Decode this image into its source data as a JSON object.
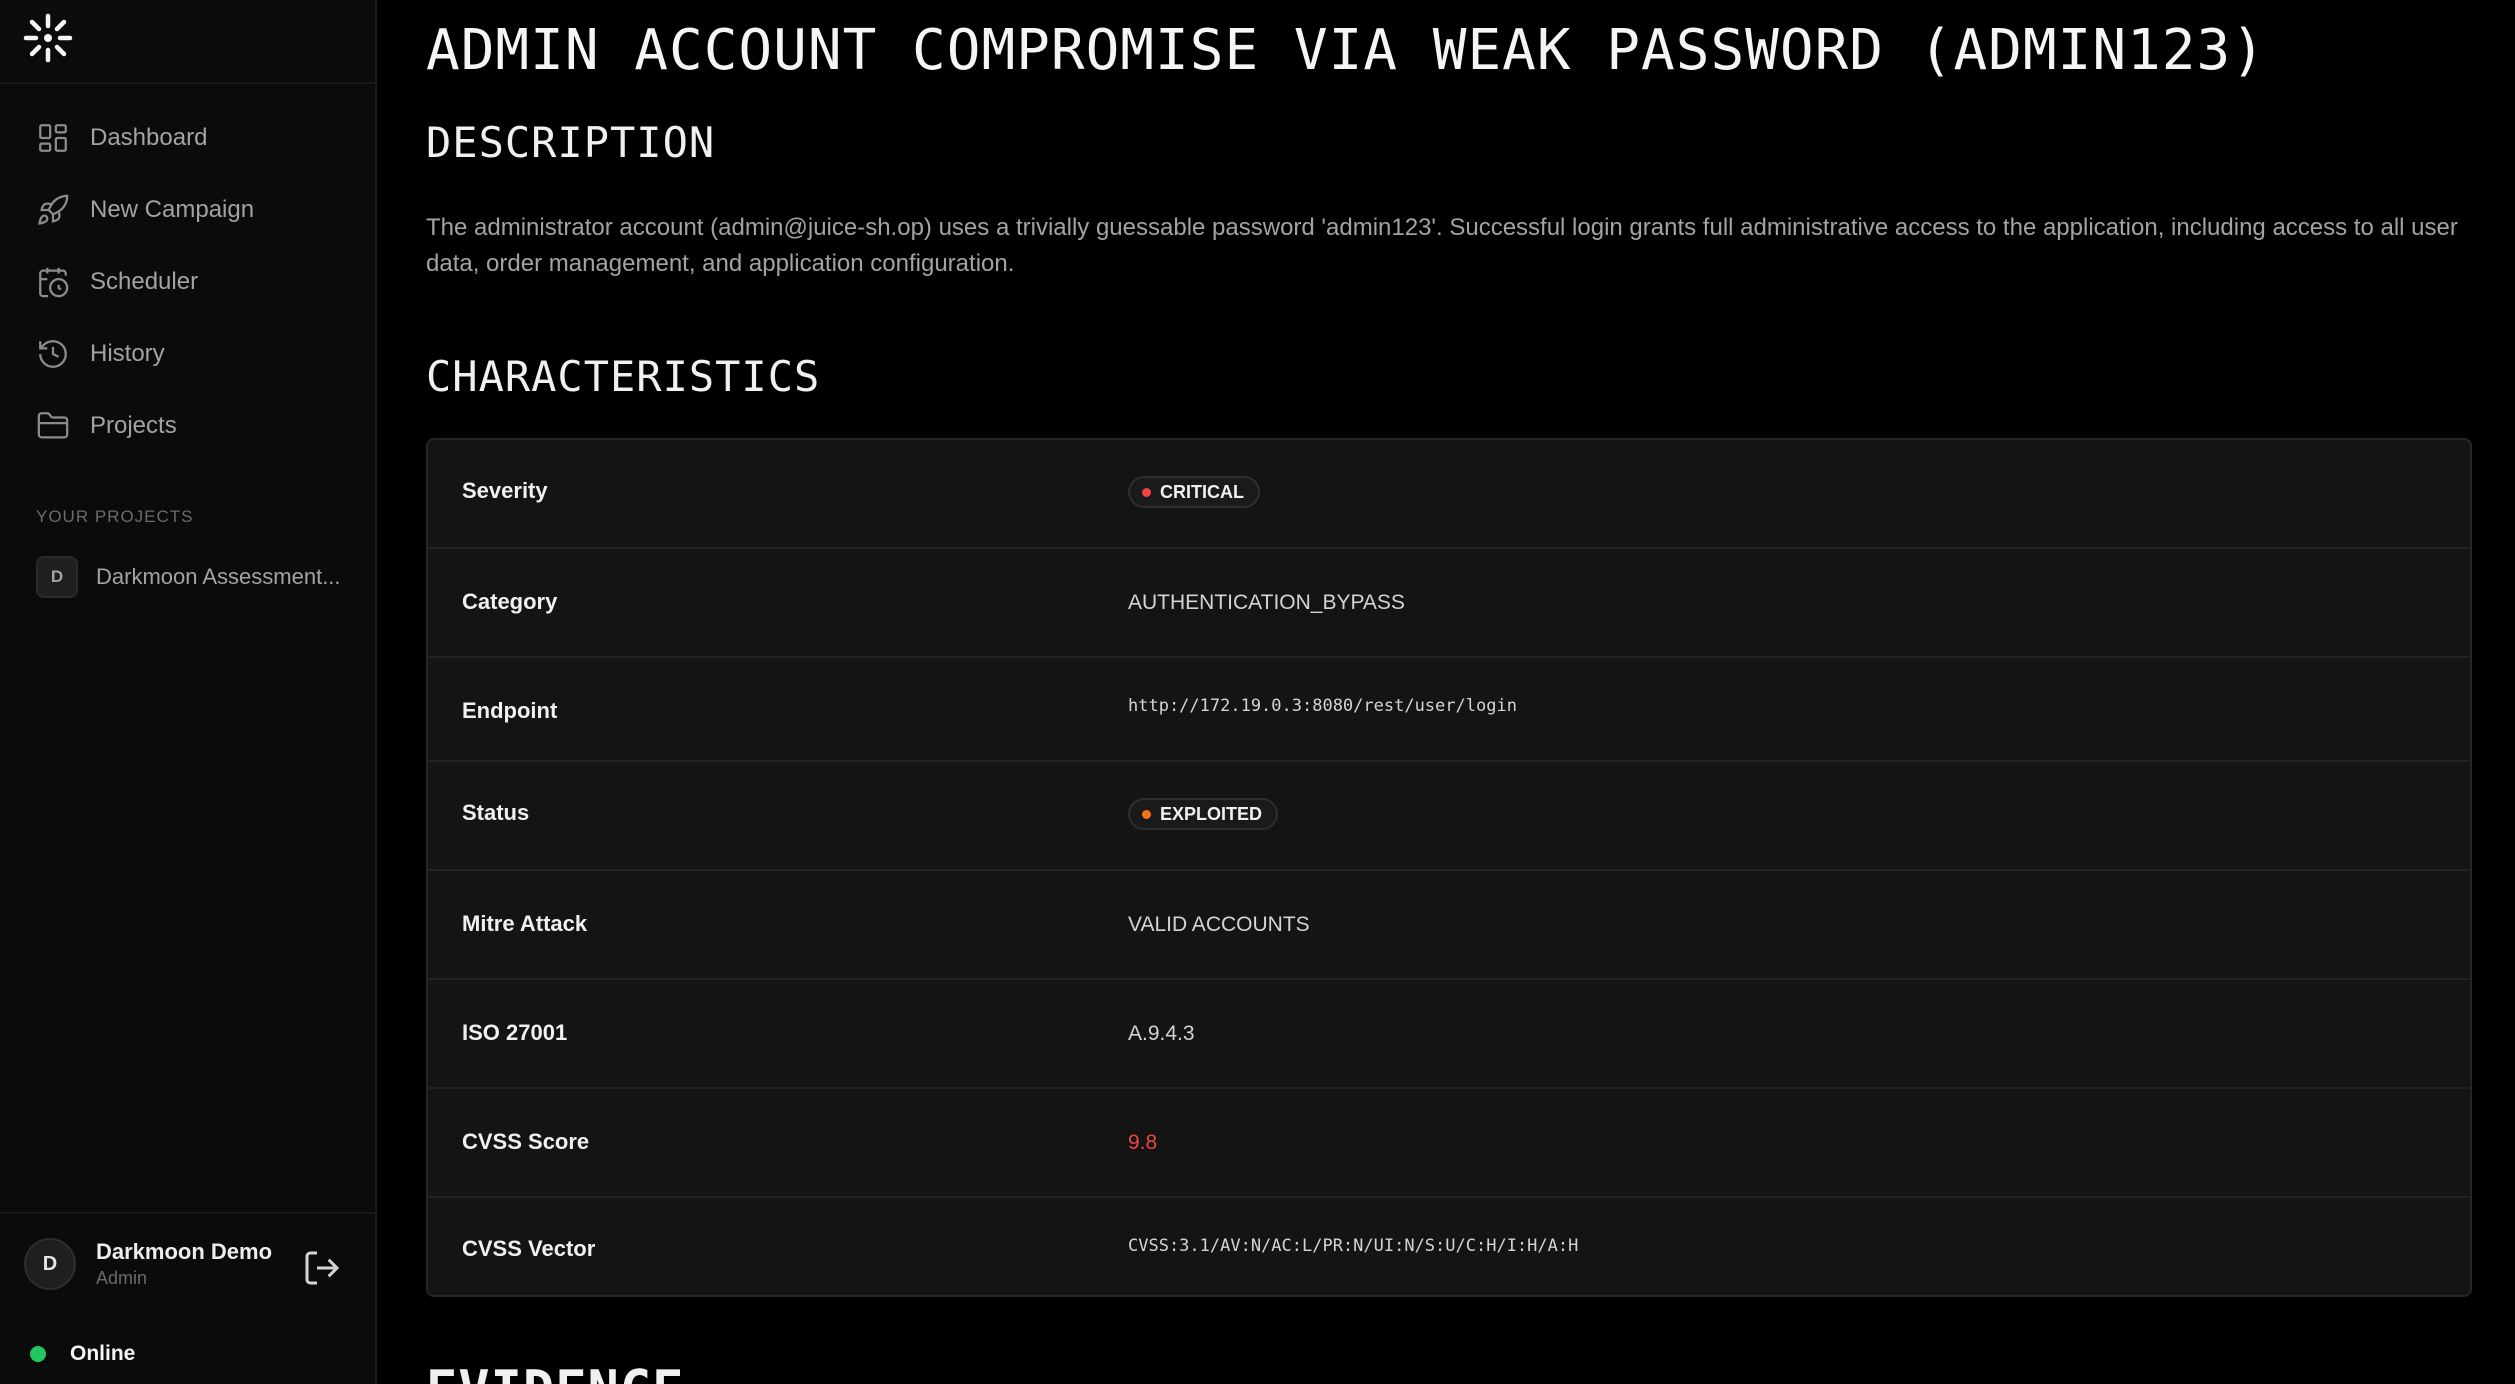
{
  "sidebar": {
    "nav": [
      {
        "label": "Dashboard",
        "icon": "dashboard-icon"
      },
      {
        "label": "New Campaign",
        "icon": "rocket-icon"
      },
      {
        "label": "Scheduler",
        "icon": "calendar-clock-icon"
      },
      {
        "label": "History",
        "icon": "history-icon"
      },
      {
        "label": "Projects",
        "icon": "folder-icon"
      }
    ],
    "section_label": "YOUR PROJECTS",
    "project": {
      "initial": "D",
      "name": "Darkmoon Assessment..."
    },
    "user": {
      "initial": "D",
      "name": "Darkmoon Demo",
      "role": "Admin"
    },
    "status": {
      "text": "Online",
      "color": "#22c55e"
    }
  },
  "main": {
    "title": "ADMIN ACCOUNT COMPROMISE VIA WEAK PASSWORD (ADMIN123)",
    "description_heading": "DESCRIPTION",
    "description": "The administrator account (admin@juice-sh.op) uses a trivially guessable password 'admin123'. Successful login grants full administrative access to the application, including access to all user data, order management, and application configuration.",
    "characteristics_heading": "CHARACTERISTICS",
    "characteristics": {
      "severity": {
        "label": "Severity",
        "value": "CRITICAL",
        "dot_color": "#ef4444"
      },
      "category": {
        "label": "Category",
        "value": "AUTHENTICATION_BYPASS"
      },
      "endpoint": {
        "label": "Endpoint",
        "value": "http://172.19.0.3:8080/rest/user/login"
      },
      "status": {
        "label": "Status",
        "value": "EXPLOITED",
        "dot_color": "#f97316"
      },
      "mitre": {
        "label": "Mitre Attack",
        "value": "VALID ACCOUNTS"
      },
      "iso": {
        "label": "ISO 27001",
        "value": "A.9.4.3"
      },
      "cvss_score": {
        "label": "CVSS Score",
        "value": "9.8",
        "color": "#ef4444"
      },
      "cvss_vector": {
        "label": "CVSS Vector",
        "value": "CVSS:3.1/AV:N/AC:L/PR:N/UI:N/S:U/C:H/I:H/A:H"
      }
    },
    "evidence_heading": "EVIDENCE"
  }
}
